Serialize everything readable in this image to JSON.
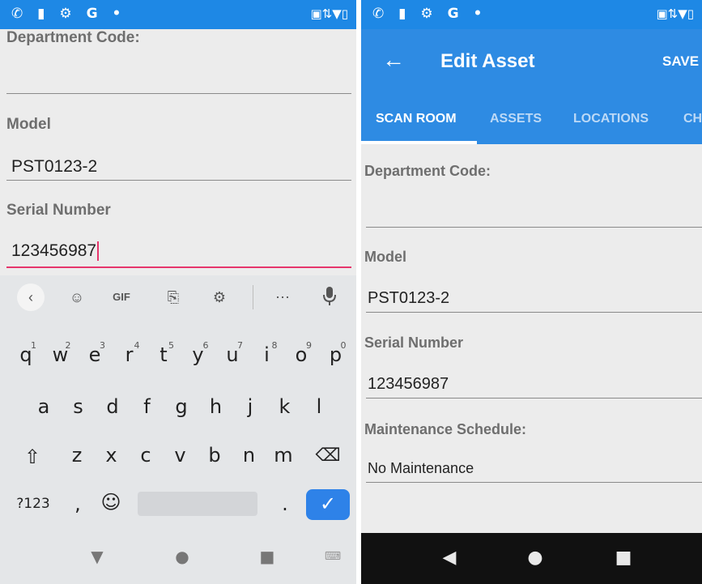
{
  "status_bar": {
    "left_icons": [
      "phone-icon",
      "battery-icon",
      "gear-icon",
      "google-icon",
      "dot-icon"
    ],
    "left_text": "✆ ▮ ⚙ G •",
    "right_text": "▣⇅▼▯"
  },
  "left": {
    "fields": {
      "department_label": "Department Code:",
      "model_label": "Model",
      "model_value": "PST0123-2",
      "serial_label": "Serial Number",
      "serial_value": "123456987"
    },
    "keyboard": {
      "toolbar": {
        "back": "‹",
        "sticker": "☺",
        "gif": "GIF",
        "clipboard": "⎘",
        "settings": "⚙",
        "more": "⋯",
        "mic": "●"
      },
      "row1": [
        {
          "char": "q",
          "num": "1"
        },
        {
          "char": "w",
          "num": "2"
        },
        {
          "char": "e",
          "num": "3"
        },
        {
          "char": "r",
          "num": "4"
        },
        {
          "char": "t",
          "num": "5"
        },
        {
          "char": "y",
          "num": "6"
        },
        {
          "char": "u",
          "num": "7"
        },
        {
          "char": "i",
          "num": "8"
        },
        {
          "char": "o",
          "num": "9"
        },
        {
          "char": "p",
          "num": "0"
        }
      ],
      "row2": [
        "a",
        "s",
        "d",
        "f",
        "g",
        "h",
        "j",
        "k",
        "l"
      ],
      "row3": [
        "z",
        "x",
        "c",
        "v",
        "b",
        "n",
        "m"
      ],
      "shift": "⇧",
      "backspace": "⌫",
      "symbols": "?123",
      "comma": ",",
      "emoji": "☺",
      "period": ".",
      "enter": "✓",
      "nav": {
        "back": "▼",
        "home": "●",
        "recents": "■",
        "keyboard": "⌨"
      }
    }
  },
  "right": {
    "appbar": {
      "back": "←",
      "title": "Edit Asset",
      "save": "SAVE"
    },
    "tabs": [
      "SCAN ROOM",
      "ASSETS",
      "LOCATIONS",
      "CH"
    ],
    "active_tab": "SCAN ROOM",
    "fields": {
      "department_label": "Department Code:",
      "model_label": "Model",
      "model_value": "PST0123-2",
      "serial_label": "Serial Number",
      "serial_value": "123456987",
      "maintenance_label": "Maintenance Schedule:",
      "maintenance_value": "No Maintenance"
    },
    "nav": {
      "back": "◀",
      "home": "●",
      "recents": "■"
    }
  },
  "colors": {
    "status_bar": "#1e88e5",
    "app_bar": "#2e8be3",
    "focus_underline": "#e6366c",
    "enter_key": "#2e82e8"
  }
}
